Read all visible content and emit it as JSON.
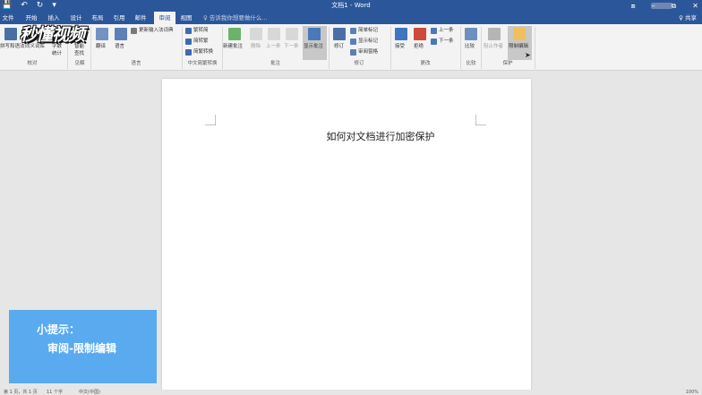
{
  "titlebar": {
    "title": "文档1 - Word",
    "qa": {
      "save": "💾",
      "undo": "↶",
      "redo": "↻",
      "more": "▾"
    },
    "wc": {
      "ribbon": "⧈",
      "minimize": "–",
      "restore": "⧉",
      "close": "✕"
    },
    "bg": "#2b579a"
  },
  "tabs": {
    "file": "文件",
    "home": "开始",
    "insert": "插入",
    "design": "设计",
    "layout": "布局",
    "references": "引用",
    "mailings": "邮件",
    "review": "审阅",
    "view": "视图",
    "tellme": "♀ 告诉我你想要做什么...",
    "share": "♀ 共享"
  },
  "ribbon": {
    "proofing": {
      "spell": "拼写和语法",
      "thesaurus": "同义词库",
      "wordcount": "字数",
      "wordcount2": "统计",
      "group": "校对"
    },
    "insights": {
      "smartlookup": "智能",
      "smartlookup2": "查找",
      "group": "见解"
    },
    "language": {
      "translate": "翻译",
      "language": "语言",
      "update_ime": "更新输入法词典",
      "group": "语言"
    },
    "chinese": {
      "t2s": "繁转简",
      "s2t": "简转繁",
      "convert": "简繁转换",
      "group": "中文简繁转换"
    },
    "comments": {
      "new": "新建批注",
      "delete": "删除",
      "prev": "上一条",
      "next": "下一条",
      "show": "显示批注",
      "group": "批注"
    },
    "tracking": {
      "track": "修订",
      "markup": "简单标记",
      "showmarkup": "显示标记",
      "pane": "审阅窗格",
      "group": "修订"
    },
    "changes": {
      "accept": "接受",
      "reject": "拒绝",
      "prev": "上一条",
      "next": "下一条",
      "group": "更改"
    },
    "compare": {
      "compare": "比较",
      "group": "比较"
    },
    "protect": {
      "block": "阻止作者",
      "restrict": "限制编辑",
      "group": "保护"
    }
  },
  "overlay_logo": "秒懂视频",
  "document": {
    "text": "如何对文档进行加密保护"
  },
  "tip": {
    "line1": "小提示：",
    "line2": "审阅-限制编辑"
  },
  "status": {
    "page": "第 1 页，共 1 页",
    "words": "11 个字",
    "lang": "中文(中国)",
    "zoom": "100%"
  }
}
